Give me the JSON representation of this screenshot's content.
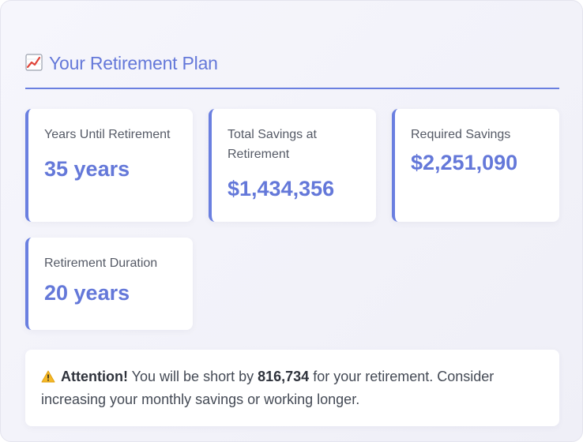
{
  "header": {
    "icon": "chart-increasing-icon",
    "title": "Your Retirement Plan"
  },
  "cards": [
    {
      "label": "Years Until Retirement",
      "value": "35 years"
    },
    {
      "label": "Total Savings at Retirement",
      "value": "$1,434,356"
    },
    {
      "label": "Required Savings",
      "value": "$2,251,090"
    },
    {
      "label": "Retirement Duration",
      "value": "20 years"
    }
  ],
  "alert": {
    "icon": "warning-icon",
    "heading": "Attention!",
    "text_before": " You will be short by ",
    "shortfall": "816,734",
    "text_after": " for your retirement. Consider increasing your monthly savings or working longer."
  },
  "colors": {
    "accent": "#6478d9",
    "accent_border": "#6a7fe0",
    "panel_bg": "#f3f3fa"
  }
}
